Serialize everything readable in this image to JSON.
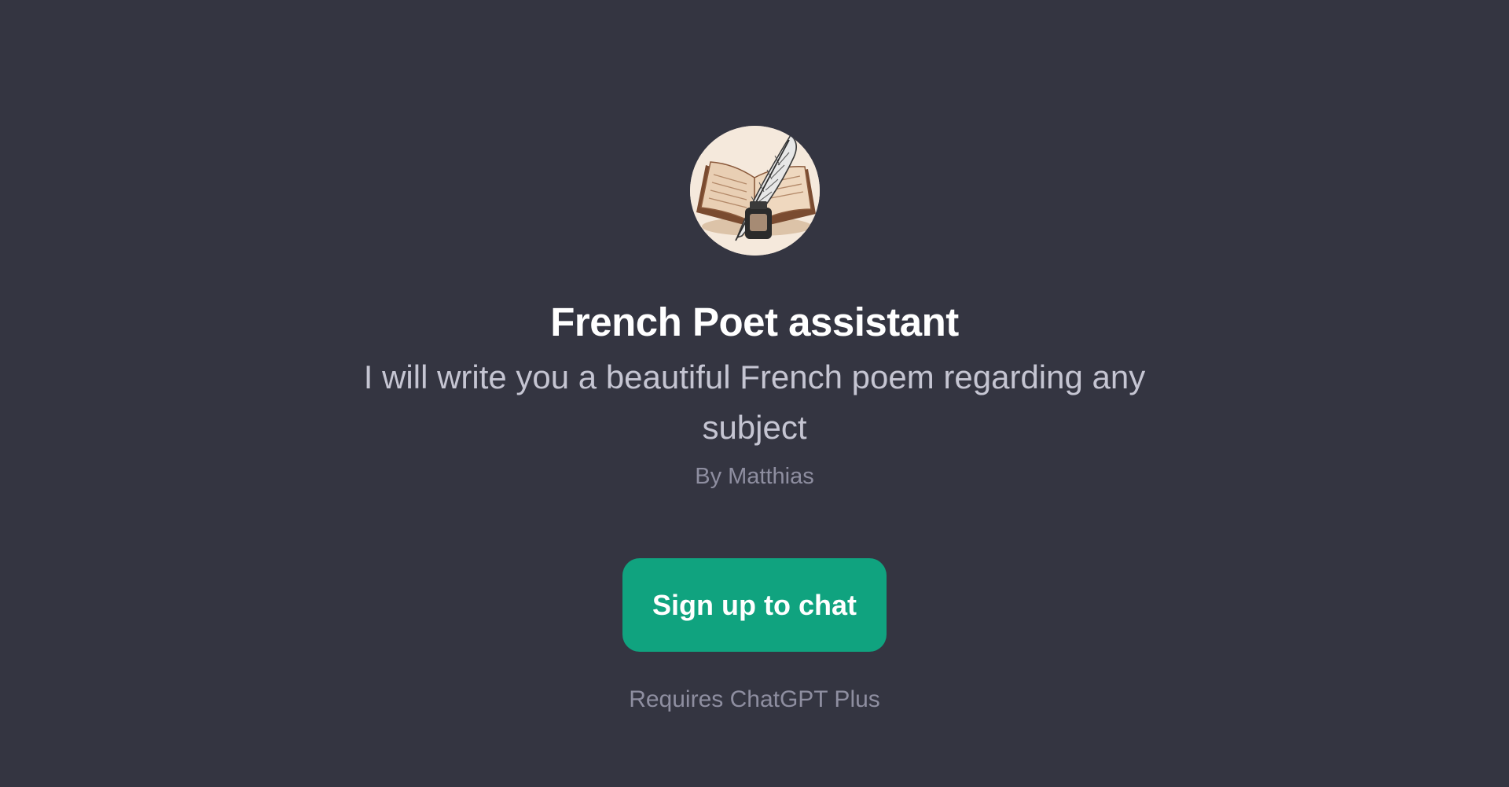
{
  "gpt": {
    "avatar_icon": "quill-and-book-icon",
    "title": "French Poet assistant",
    "description": "I will write you a beautiful French poem regarding any subject",
    "author": "By Matthias"
  },
  "actions": {
    "signup_label": "Sign up to chat",
    "requirement_note": "Requires ChatGPT Plus"
  },
  "colors": {
    "background": "#343541",
    "accent": "#10a37f",
    "title": "#ffffff",
    "description": "#c5c5d2",
    "muted": "#8e8ea0"
  }
}
